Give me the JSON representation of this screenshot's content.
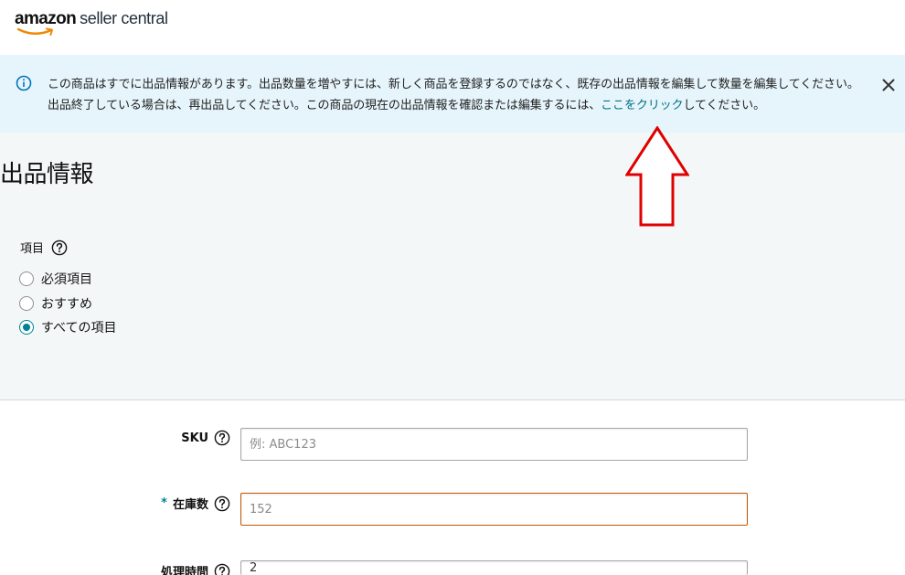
{
  "header": {
    "logo_amazon": "amazon",
    "logo_product": "seller central"
  },
  "banner": {
    "line1": "この商品はすでに出品情報があります。出品数量を増やすには、新しく商品を登録するのではなく、既存の出品情報を編集して数量を編集してください。",
    "line2_before": "出品終了している場合は、再出品してください。この商品の現在の出品情報を確認または編集するには、",
    "link": "ここをクリック",
    "line2_after": "してください。"
  },
  "page": {
    "title": "出品情報"
  },
  "items_filter": {
    "label": "項目",
    "options": [
      {
        "label": "必須項目",
        "checked": false
      },
      {
        "label": "おすすめ",
        "checked": false
      },
      {
        "label": "すべての項目",
        "checked": true
      }
    ]
  },
  "form": {
    "sku": {
      "label": "SKU",
      "placeholder": "例: ABC123",
      "value": ""
    },
    "quantity": {
      "required_mark": "*",
      "label": "在庫数",
      "value": "152"
    },
    "handling_time": {
      "label": "処理時間",
      "value": "2"
    }
  },
  "colors": {
    "accent": "#008296",
    "link": "#007185",
    "banner_bg": "#e6f4fb",
    "section_bg": "#f4f7f7",
    "arrow": "#e00000",
    "warn_border": "#c45500"
  }
}
